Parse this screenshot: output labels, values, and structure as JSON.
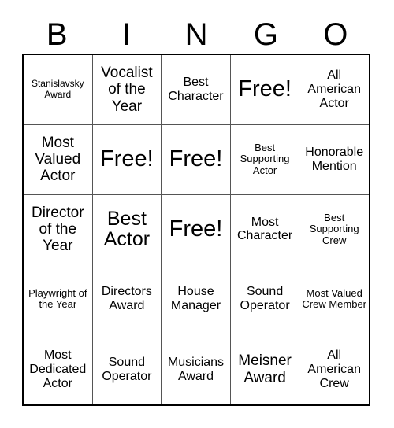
{
  "header": {
    "letters": [
      "B",
      "I",
      "N",
      "G",
      "O"
    ]
  },
  "grid": {
    "rows": [
      [
        {
          "text": "Stanislavsky Award",
          "size": "xs"
        },
        {
          "text": "Vocalist of the Year",
          "size": "lg"
        },
        {
          "text": "Best Character",
          "size": "md"
        },
        {
          "text": "Free!",
          "size": "free"
        },
        {
          "text": "All American Actor",
          "size": "md"
        }
      ],
      [
        {
          "text": "Most Valued Actor",
          "size": "lg"
        },
        {
          "text": "Free!",
          "size": "free"
        },
        {
          "text": "Free!",
          "size": "free"
        },
        {
          "text": "Best Supporting Actor",
          "size": "sm"
        },
        {
          "text": "Honorable Mention",
          "size": "md"
        }
      ],
      [
        {
          "text": "Director of the Year",
          "size": "lg"
        },
        {
          "text": "Best Actor",
          "size": "xl"
        },
        {
          "text": "Free!",
          "size": "free"
        },
        {
          "text": "Most Character",
          "size": "md"
        },
        {
          "text": "Best Supporting Crew",
          "size": "sm"
        }
      ],
      [
        {
          "text": "Playwright of the Year",
          "size": "sm"
        },
        {
          "text": "Directors Award",
          "size": "md"
        },
        {
          "text": "House Manager",
          "size": "md"
        },
        {
          "text": "Sound Operator",
          "size": "md"
        },
        {
          "text": "Most Valued Crew Member",
          "size": "sm"
        }
      ],
      [
        {
          "text": "Most Dedicated Actor",
          "size": "md"
        },
        {
          "text": "Sound Operator",
          "size": "md"
        },
        {
          "text": "Musicians Award",
          "size": "md"
        },
        {
          "text": "Meisner Award",
          "size": "lg"
        },
        {
          "text": "All American Crew",
          "size": "md"
        }
      ]
    ]
  },
  "colors": {
    "background": "#ffffff",
    "text": "#000000",
    "grid_outer_border": "#000000",
    "grid_inner_border": "#555555"
  }
}
